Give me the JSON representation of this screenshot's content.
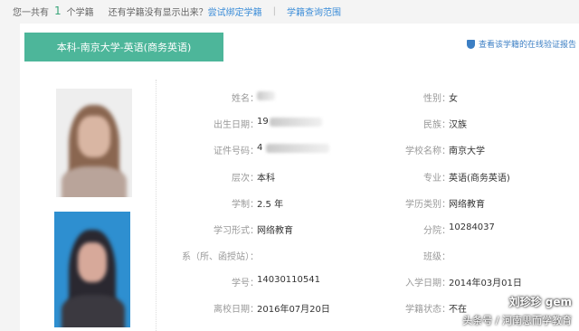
{
  "topbar": {
    "prefix": "您一共有",
    "count": "1",
    "suffix": "个学籍",
    "question": "还有学籍没有显示出来？",
    "bind_link": "尝试绑定学籍",
    "separator": "|",
    "query_link": "学籍查询范围"
  },
  "tab": {
    "label": "本科-南京大学-英语(商务英语)"
  },
  "verify_link": "查看该学籍的在线验证报告",
  "fields_left": [
    {
      "label": "姓名：",
      "value": ""
    },
    {
      "label": "出生日期：",
      "value": "19"
    },
    {
      "label": "证件号码：",
      "value": "4"
    },
    {
      "label": "层次：",
      "value": "本科"
    },
    {
      "label": "学制：",
      "value": "2.5 年"
    },
    {
      "label": "学习形式：",
      "value": "网络教育"
    },
    {
      "label": "系（所、函授站）：",
      "value": ""
    },
    {
      "label": "学号：",
      "value": "14030110541"
    },
    {
      "label": "离校日期：",
      "value": "2016年07月20日"
    }
  ],
  "fields_right": [
    {
      "label": "性别：",
      "value": "女"
    },
    {
      "label": "民族：",
      "value": "汉族"
    },
    {
      "label": "学校名称：",
      "value": "南京大学"
    },
    {
      "label": "专业：",
      "value": "英语(商务英语)"
    },
    {
      "label": "学历类别：",
      "value": "网络教育"
    },
    {
      "label": "分院：",
      "value": "10284037"
    },
    {
      "label": "班级：",
      "value": ""
    },
    {
      "label": "入学日期：",
      "value": "2014年03月01日"
    },
    {
      "label": "学籍状态：",
      "value": "不在"
    }
  ],
  "watermark": {
    "line1": "刘珍珍 gem",
    "line2": "头条号 / 河南思而学教育"
  }
}
